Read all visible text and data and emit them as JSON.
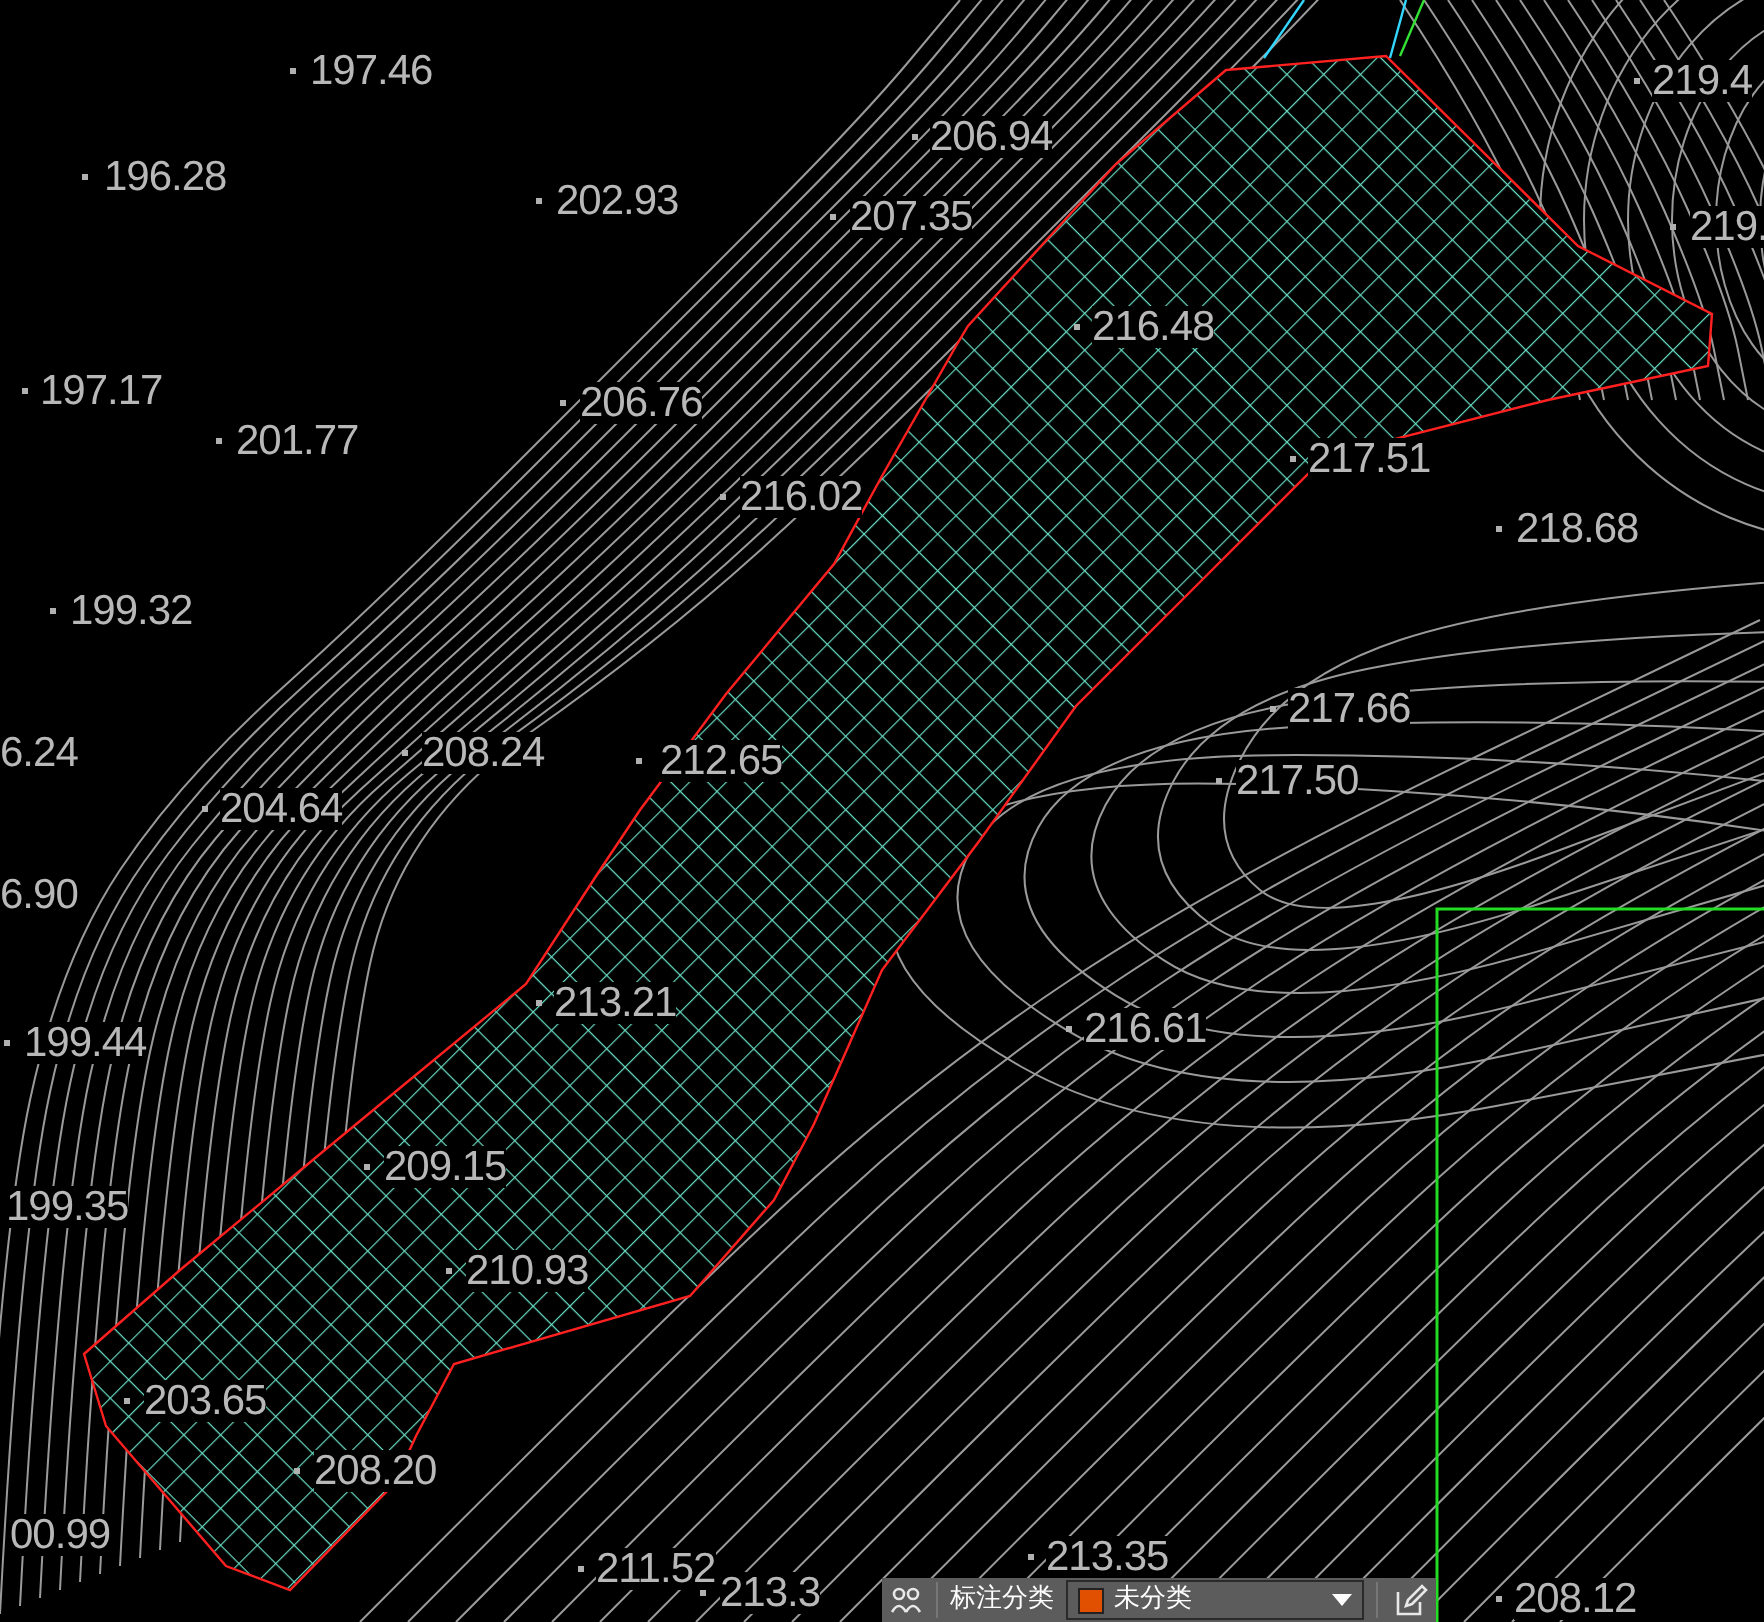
{
  "drawing": {
    "elevation_labels": [
      {
        "text": "197.46"
      },
      {
        "text": "196.28"
      },
      {
        "text": "202.93"
      },
      {
        "text": "206.94"
      },
      {
        "text": "207.35"
      },
      {
        "text": "219.4"
      },
      {
        "text": "219."
      },
      {
        "text": "216.48"
      },
      {
        "text": "197.17"
      },
      {
        "text": "206.76"
      },
      {
        "text": "201.77"
      },
      {
        "text": "216.02"
      },
      {
        "text": "217.51"
      },
      {
        "text": "218.68"
      },
      {
        "text": "199.32"
      },
      {
        "text": "217.66"
      },
      {
        "text": "6.24"
      },
      {
        "text": "208.24"
      },
      {
        "text": "212.65"
      },
      {
        "text": "217.50"
      },
      {
        "text": "204.64"
      },
      {
        "text": "6.90"
      },
      {
        "text": "216.61"
      },
      {
        "text": "199.44"
      },
      {
        "text": "213.21"
      },
      {
        "text": "209.15"
      },
      {
        "text": "199.35"
      },
      {
        "text": "210.93"
      },
      {
        "text": "203.65"
      },
      {
        "text": "208.20"
      },
      {
        "text": "00.99"
      },
      {
        "text": "211.52"
      },
      {
        "text": "213.35"
      },
      {
        "text": "213.3"
      },
      {
        "text": "208.12"
      }
    ]
  },
  "toolbar": {
    "category_label": "标注分类",
    "category_dropdown": {
      "value": "未分类",
      "color": "#e05000"
    }
  }
}
